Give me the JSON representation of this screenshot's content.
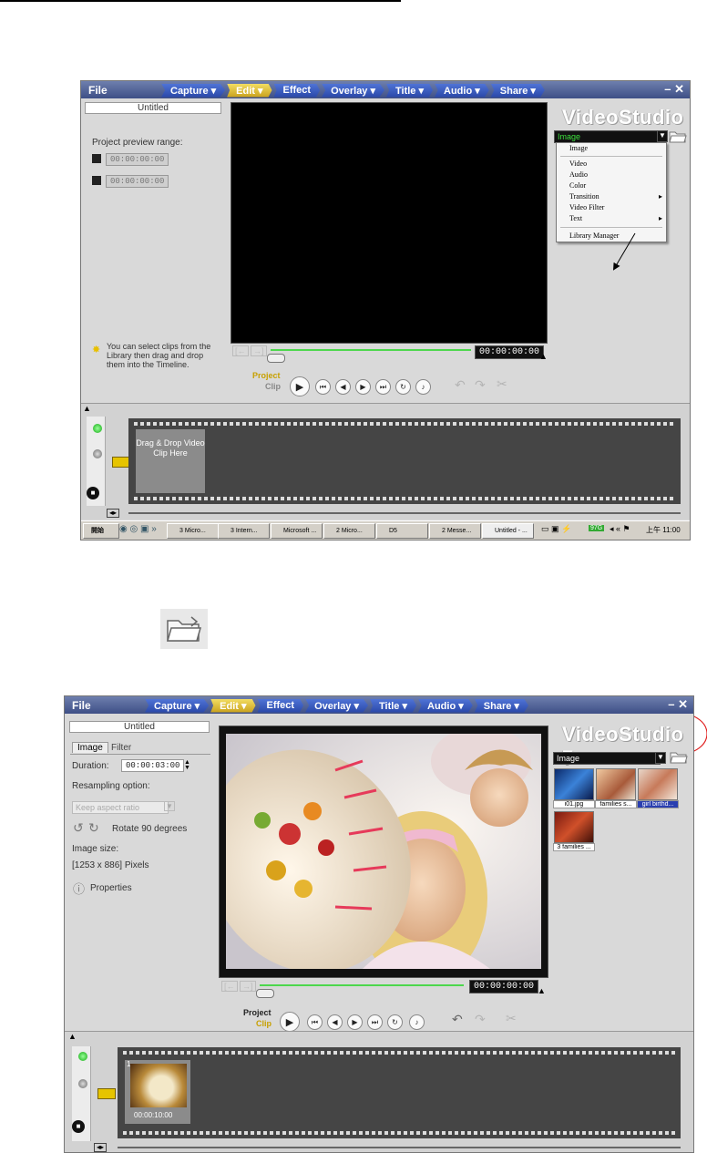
{
  "menu": {
    "file": "File",
    "tabs": [
      "Capture ▾",
      "Edit ▾",
      "Effect",
      "Overlay ▾",
      "Title ▾",
      "Audio ▾",
      "Share ▾"
    ],
    "window_controls": "– ✕"
  },
  "brand": "VideoStudio 7",
  "screenshot1": {
    "title": "Untitled",
    "preview_range_label": "Project preview range:",
    "range_start": "00:00:00:00",
    "range_end": "00:00:00:00",
    "timecode": "00:00:00:00",
    "tip": "You can select clips from the Library then drag and drop them into the Timeline.",
    "project_label": "Project",
    "clip_label": "Clip",
    "library_dropdown": "Image",
    "library_menu": [
      "Image",
      "Video",
      "Audio",
      "Color",
      "Transition",
      "Video Filter",
      "Text",
      "Library Manager"
    ],
    "drop_hint": "Drag & Drop Video Clip Here",
    "taskbar": {
      "start": "開始",
      "items": [
        "3 Micro...",
        "3 Intern...",
        "Microsoft ...",
        "2 Micro...",
        "D5",
        "2 Messe...",
        "Untitled - ..."
      ],
      "tray_badge": "97G",
      "clock": "上午 11:00"
    }
  },
  "screenshot2": {
    "title": "Untitled",
    "tabs": [
      "Image",
      "Filter"
    ],
    "duration_label": "Duration:",
    "duration_value": "00:00:03:00",
    "resampling_label": "Resampling option:",
    "resampling_value": "Keep aspect ratio",
    "rotate_label": "Rotate 90 degrees",
    "image_size_label": "Image size:",
    "image_size_value": "[1253 x 886] Pixels",
    "properties_label": "Properties",
    "timecode": "00:00:00:00",
    "project_label": "Project",
    "clip_label": "Clip",
    "library_dropdown": "Image",
    "thumbs": [
      "i01.jpg",
      "families s...",
      "girl birthd...",
      "3 families ..."
    ],
    "clip_number": "1",
    "clip_duration": "00:00:10:00"
  }
}
